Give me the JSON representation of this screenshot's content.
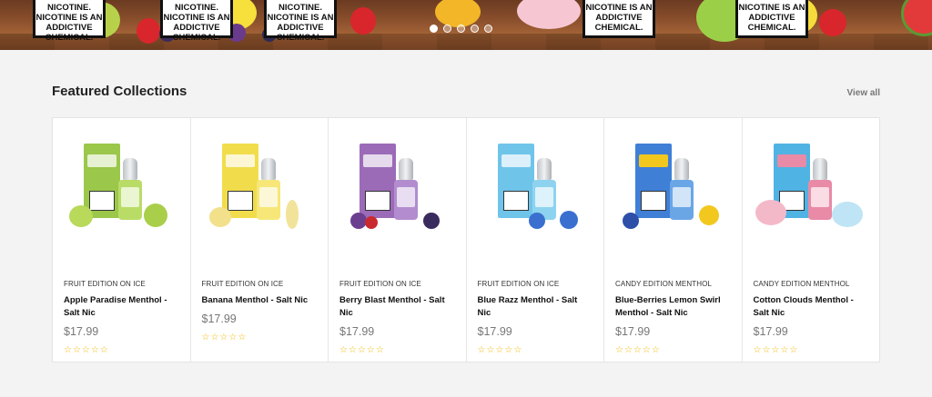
{
  "banner": {
    "warnings": [
      "NICOTINE. NICOTINE IS AN ADDICTIVE CHEMICAL.",
      "NICOTINE. NICOTINE IS AN ADDICTIVE CHEMICAL.",
      "NICOTINE IS AN ADDICTIVE CHEMICAL."
    ],
    "slide_count": 5,
    "active_slide": 1
  },
  "section": {
    "title": "Featured Collections",
    "view_all": "View all"
  },
  "products": [
    {
      "category": "FRUIT EDITION ON ICE",
      "name": "Apple Paradise Menthol - Salt Nic",
      "price": "$17.99",
      "rating": 0,
      "box_color": "#9bc74a",
      "bottle_color": "#b9dc66",
      "fruit_color": "#b8d95a"
    },
    {
      "category": "FRUIT EDITION ON ICE",
      "name": "Banana Menthol - Salt Nic",
      "price": "$17.99",
      "rating": 0,
      "box_color": "#f1dd4c",
      "bottle_color": "#f6e778",
      "fruit_color": "#f3e08a"
    },
    {
      "category": "FRUIT EDITION ON ICE",
      "name": "Berry Blast Menthol - Salt Nic",
      "price": "$17.99",
      "rating": 0,
      "box_color": "#9b6bb8",
      "bottle_color": "#b38ccf",
      "fruit_color": "#6b3f8f"
    },
    {
      "category": "FRUIT EDITION ON ICE",
      "name": "Blue Razz Menthol - Salt Nic",
      "price": "$17.99",
      "rating": 0,
      "box_color": "#6fc4ea",
      "bottle_color": "#8dd3f0",
      "fruit_color": "#3a6fd0"
    },
    {
      "category": "CANDY EDITION MENTHOL",
      "name": "Blue-Berries Lemon Swirl Menthol - Salt Nic",
      "price": "$17.99",
      "rating": 0,
      "box_color": "#3f7fd6",
      "bottle_color": "#6aa6e6",
      "fruit_color": "#f2c81f"
    },
    {
      "category": "CANDY EDITION MENTHOL",
      "name": "Cotton Clouds Menthol - Salt Nic",
      "price": "$17.99",
      "rating": 0,
      "box_color": "#4fb3e3",
      "bottle_color": "#e98aa6",
      "fruit_color": "#f4b9c9"
    }
  ],
  "star_glyph": "☆☆☆☆☆"
}
